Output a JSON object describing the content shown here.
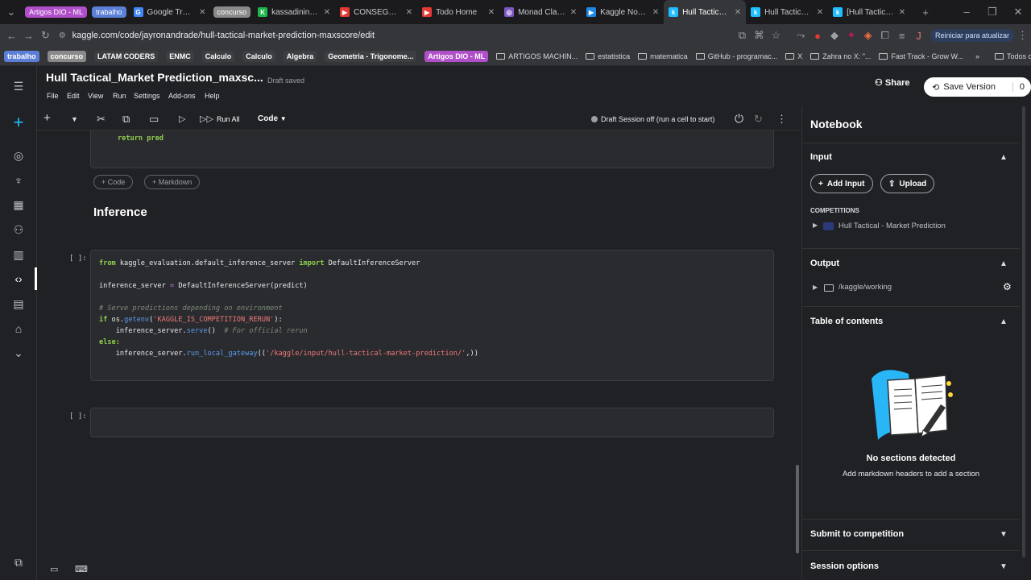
{
  "browser": {
    "tabs": [
      {
        "label": "",
        "active": false
      },
      {
        "label": "Artigos DIO - ML",
        "group": true,
        "color": "#b04fc9"
      },
      {
        "label": "trabalho",
        "group": true,
        "color": "#5b7fd6"
      },
      {
        "label": "Google Tradutor",
        "active": false,
        "fav": "G",
        "favcolor": "#4285f4"
      },
      {
        "label": "concurso",
        "group": true,
        "color": "#8a8a8a"
      },
      {
        "label": "kassadinincel Si",
        "active": false,
        "fav": "K",
        "favcolor": "#1fb64b"
      },
      {
        "label": "CONSEGUI UM",
        "active": false,
        "fav": "▶",
        "favcolor": "#e53935"
      },
      {
        "label": "Todo Home",
        "active": false,
        "fav": "▶",
        "favcolor": "#e53935"
      },
      {
        "label": "Monad Claim P",
        "active": false,
        "fav": "◎",
        "favcolor": "#7e57c2"
      },
      {
        "label": "Kaggle Noteboo",
        "active": false,
        "fav": "▶",
        "favcolor": "#1e88e5"
      },
      {
        "label": "Hull Tactical_M",
        "active": true,
        "fav": "k",
        "favcolor": "#20beff"
      },
      {
        "label": "Hull Tactical - M",
        "active": false,
        "fav": "k",
        "favcolor": "#20beff"
      },
      {
        "label": "[Hull Tactical] B",
        "active": false,
        "fav": "k",
        "favcolor": "#20beff"
      }
    ],
    "url": "kaggle.com/code/jayronandrade/hull-tactical-market-prediction-maxscore/edit",
    "update_label": "Reiniciar para atualizar",
    "bookmarks": [
      {
        "label": "trabalho",
        "chip": true,
        "color": "#5b7fd6"
      },
      {
        "label": "concurso",
        "chip": true,
        "color": "#8a8a8a"
      },
      {
        "label": "LATAM CODERS",
        "chip": true,
        "color": "#3d3e42"
      },
      {
        "label": "ENMC",
        "chip": true,
        "color": "#3d3e42"
      },
      {
        "label": "Calculo",
        "chip": true,
        "color": "#3d3e42"
      },
      {
        "label": "Calculo",
        "chip": true,
        "color": "#3d3e42"
      },
      {
        "label": "Algebra",
        "chip": true,
        "color": "#3d3e42"
      },
      {
        "label": "Geometria - Trigonome...",
        "chip": true,
        "color": "#3d3e42"
      },
      {
        "label": "Artigos DIO - ML",
        "chip": true,
        "color": "#b04fc9"
      },
      {
        "label": "ARTIGOS MACHIN...",
        "chip": false
      },
      {
        "label": "estatistica",
        "chip": false
      },
      {
        "label": "matematica",
        "chip": false
      },
      {
        "label": "GitHub - programac...",
        "chip": false
      },
      {
        "label": "X",
        "chip": false
      },
      {
        "label": "Zahra no X: \"...",
        "chip": false
      },
      {
        "label": "Fast Track - Grow W...",
        "chip": false
      }
    ],
    "all_bookmarks": "Todos os favoritos"
  },
  "kaggle": {
    "notebook_title": "Hull Tactical_Market Prediction_maxsc...",
    "draft_saved": "Draft saved",
    "menu": [
      "File",
      "Edit",
      "View",
      "Run",
      "Settings",
      "Add-ons",
      "Help"
    ],
    "share_label": "Share",
    "save_version_label": "Save Version",
    "save_version_count": "0",
    "run_all_label": "Run All",
    "cell_type": "Code",
    "session_status": "Draft Session off (run a cell to start)",
    "add_code_label": "+ Code",
    "add_markdown_label": "+ Markdown",
    "prev_cell_last_line": "return pred",
    "heading": "Inference",
    "prompt": "[ ]:",
    "cell_lines": [
      "from kaggle_evaluation.default_inference_server import DefaultInferenceServer",
      "",
      "inference_server = DefaultInferenceServer(predict)",
      "",
      "# Serve predictions depending on environment",
      "if os.getenv('KAGGLE_IS_COMPETITION_RERUN'):",
      "    inference_server.serve()  # For official rerun",
      "else:",
      "    inference_server.run_local_gateway(('/kaggle/input/hull-tactical-market-prediction/',))"
    ],
    "panel": {
      "title": "Notebook",
      "input_label": "Input",
      "add_input_label": "Add Input",
      "upload_label": "Upload",
      "competitions_label": "COMPETITIONS",
      "competition_name": "Hull Tactical - Market Prediction",
      "output_label": "Output",
      "output_path": "/kaggle/working",
      "toc_label": "Table of contents",
      "no_sections": "No sections detected",
      "no_sections_sub": "Add markdown headers to add a section",
      "submit_label": "Submit to competition",
      "session_options_label": "Session options"
    }
  }
}
